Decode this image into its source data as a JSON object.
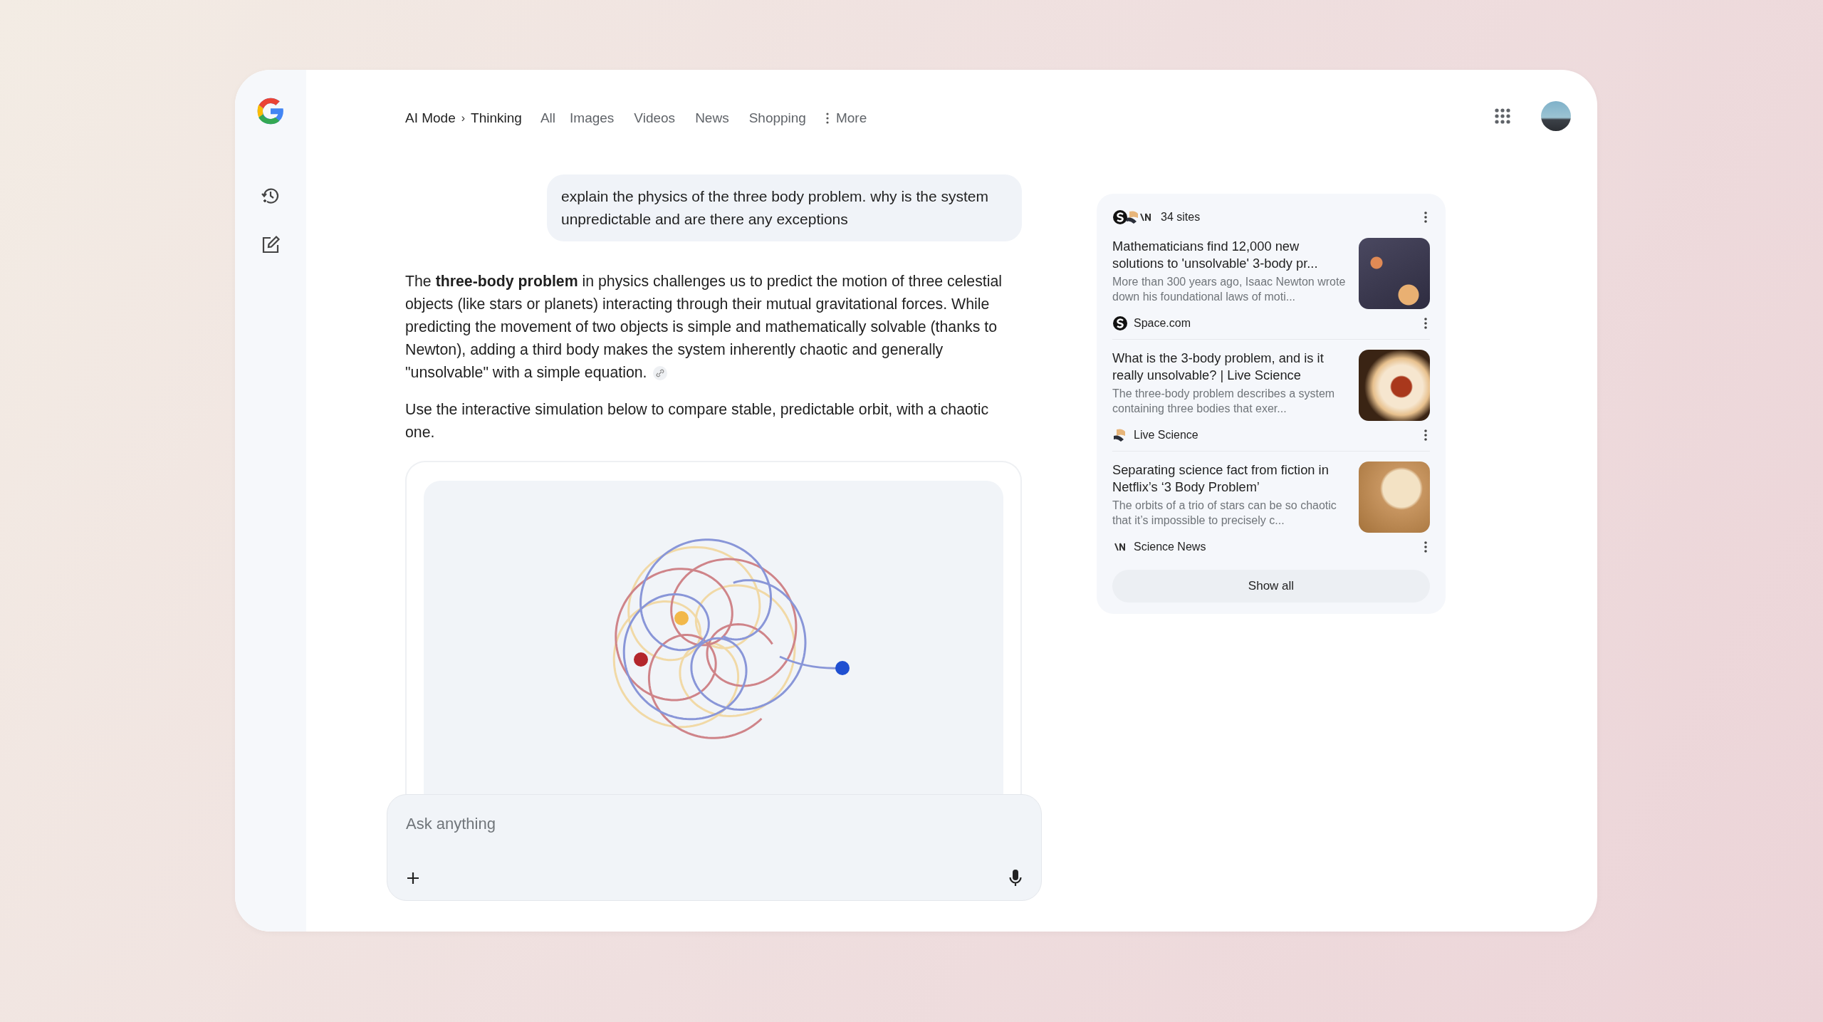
{
  "breadcrumb": {
    "items": [
      "AI Mode",
      "Thinking"
    ],
    "separator": "›"
  },
  "tabs": [
    {
      "label": "All",
      "selected": false,
      "kind": "plain"
    },
    {
      "label": "Images",
      "selected": false,
      "kind": "plain"
    },
    {
      "label": "Videos",
      "selected": false,
      "kind": "plain"
    },
    {
      "label": "News",
      "selected": false,
      "kind": "plain"
    },
    {
      "label": "Shopping",
      "selected": false,
      "kind": "plain"
    },
    {
      "label": "More",
      "selected": false,
      "kind": "menu"
    }
  ],
  "query": "explain the physics of the three body problem. why is the system unpredictable and are there any exceptions",
  "answer": [
    "The **three-body problem** in physics challenges us to predict the motion of three celestial objects (like stars or planets) interacting through their mutual gravitational forces. While predicting the movement of two objects is simple and mathematically solvable (thanks to Newton), adding a third body makes the system inherently chaotic and generally \"unsolvable\" with a simple equation.",
    "Use the interactive simulation below to compare stable, predictable orbit, with a chaotic one."
  ],
  "sources": {
    "count": "34 sites",
    "items": [
      {
        "title": "Mathematicians find 12,000 new solutions to 'unsolvable' 3-body pr...",
        "snippet": "More than 300 years ago, Isaac Newton wrote down his foundational laws of moti...",
        "site": "Space.com",
        "kind": "disc"
      },
      {
        "title": "What is the 3-body problem, and is it really unsolvable? | Live Science",
        "snippet": "The three-body problem describes a system containing three bodies that exer...",
        "site": "Live Science",
        "kind": "wave"
      },
      {
        "title": "Separating science fact from fiction in Netflix’s ‘3 Body Problem’",
        "snippet": "The orbits of a trio of stars can be so chaotic that it’s impossible to precisely c...",
        "site": "Science News",
        "kind": "bars"
      }
    ],
    "show_all": "Show all"
  },
  "input": {
    "placeholder": "Ask anything"
  }
}
